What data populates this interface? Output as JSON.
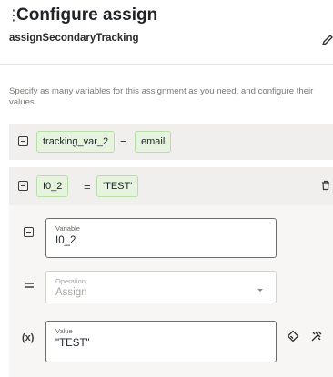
{
  "header": {
    "title": "Configure assign",
    "subtitle": "assignSecondaryTracking"
  },
  "helper_text": "Specify as many variables for this assignment as you need, and configure their values.",
  "assignments": [
    {
      "variable": "tracking_var_2",
      "operator": "=",
      "value": "email"
    },
    {
      "variable": "I0_2",
      "operator": "=",
      "value": "'TEST'"
    }
  ],
  "editor": {
    "variable": {
      "label": "Variable",
      "value": "I0_2"
    },
    "operation": {
      "label": "Operation",
      "value": "Assign"
    },
    "value": {
      "label": "Value",
      "value": "\"TEST\""
    },
    "value_prefix": "(x)",
    "operation_prefix": "="
  },
  "icons": {
    "drag": "drag-handle-icon",
    "edit": "pencil-icon",
    "collapse": "collapse-icon",
    "delete": "trash-icon",
    "clear": "eraser-icon",
    "mapper": "mapper-icon"
  },
  "colors": {
    "chip_bg": "#e6f4df",
    "chip_border": "#b8dfa8",
    "row_bg": "#f1efed"
  }
}
